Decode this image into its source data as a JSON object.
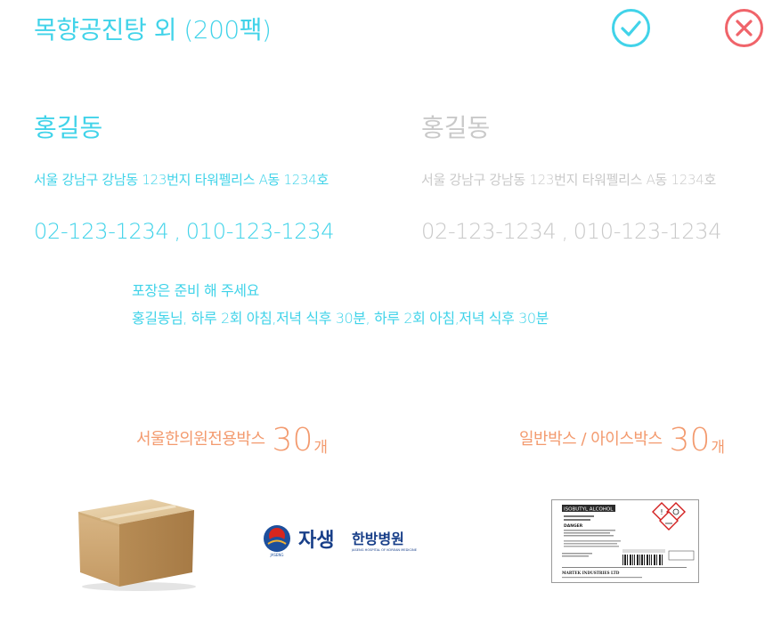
{
  "title": "목향공진탕 외 (200팩)",
  "icons": {
    "confirm": "check-circle-icon",
    "close": "x-circle-icon"
  },
  "colors": {
    "accent": "#41d3e9",
    "muted": "#c9c9c9",
    "highlight": "#f39a6e",
    "close": "#f0646a"
  },
  "recipient": {
    "name": "홍길동",
    "address": "서울 강남구 강남동 123번지 타워펠리스 A동 1234호",
    "phone": "02-123-1234",
    "mobile": "010-123-1234",
    "separator": ","
  },
  "sender": {
    "name": "홍길동",
    "address": "서울 강남구 강남동 123번지 타워펠리스 A동 1234호",
    "phone": "02-123-1234",
    "mobile": "010-123-1234",
    "separator": ","
  },
  "memo": {
    "line1": "포장은 준비 해 주세요",
    "line2": "홍길동님,  하루 2회  아침,저녁 식후 30분, 하루 2회  아침,저녁 식후 30분"
  },
  "boxes": [
    {
      "label": "서울한의원전용박스",
      "count": "30",
      "unit": "개"
    },
    {
      "label": "일반박스 / 아이스박스",
      "count": "30",
      "unit": "개"
    }
  ],
  "hospital_logo": {
    "main": "자생",
    "sub": "한방병원",
    "tagline": "JASENG HOSPITAL OF KOREAN MEDICINE",
    "emblem_text": "JASENG"
  },
  "shipping_label": {
    "product": "ISOBUTYL ALCOHOL",
    "hazard": "DANGER",
    "company": "MARTEK INDUSTRIES LTD"
  }
}
